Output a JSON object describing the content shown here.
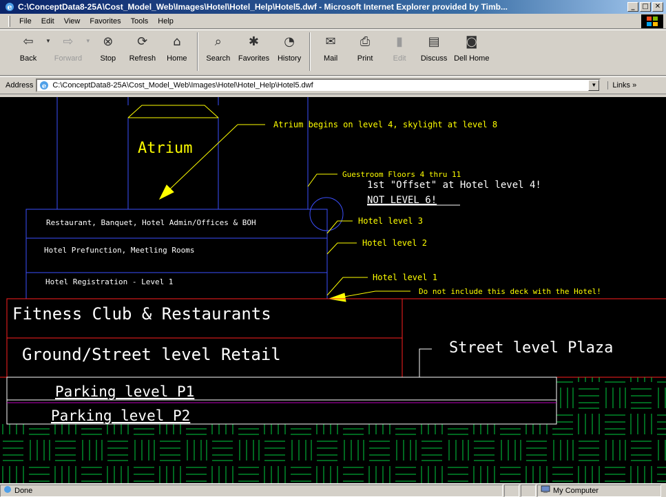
{
  "window": {
    "title": "C:\\ConceptData8-25A\\Cost_Model_Web\\Images\\Hotel\\Hotel_Help\\Hotel5.dwf - Microsoft Internet Explorer provided by Timb...",
    "minimize": "_",
    "maximize": "□",
    "close": "✕"
  },
  "menu": {
    "items": [
      "File",
      "Edit",
      "View",
      "Favorites",
      "Tools",
      "Help"
    ]
  },
  "toolbar": {
    "back": "Back",
    "forward": "Forward",
    "stop": "Stop",
    "refresh": "Refresh",
    "home": "Home",
    "search": "Search",
    "favorites": "Favorites",
    "history": "History",
    "mail": "Mail",
    "print": "Print",
    "edit": "Edit",
    "discuss": "Discuss",
    "dellhome": "Dell Home"
  },
  "address": {
    "label": "Address",
    "url": "C:\\ConceptData8-25A\\Cost_Model_Web\\Images\\Hotel\\Hotel_Help\\Hotel5.dwf",
    "links": "Links »"
  },
  "drawing": {
    "atrium": "Atrium",
    "atrium_note": "Atrium begins on level 4, skylight at level 8",
    "guestroom_note": "Guestroom Floors 4 thru 11",
    "offset_note": "1st \"Offset\" at Hotel level 4!",
    "not_level": "NOT LEVEL 6!",
    "level3_box": "Restaurant, Banquet, Hotel Admin/Offices & BOH",
    "level3_label": "Hotel level 3",
    "level2_box": "Hotel Prefunction, Meetling Rooms",
    "level2_label": "Hotel level 2",
    "level1_box": "Hotel Registration - Level 1",
    "level1_label": "Hotel level 1",
    "deck_note": "Do not include this deck with the Hotel!",
    "fitness": "Fitness Club & Restaurants",
    "retail": "Ground/Street level Retail",
    "plaza": "Street level Plaza",
    "parking1": "Parking level P1",
    "parking2": "Parking level P2",
    "colors": {
      "yellow": "#ffff00",
      "blue": "#3c50ff",
      "red": "#ff2020",
      "green": "#00d040",
      "white": "#ffffff"
    }
  },
  "status": {
    "text": "Done",
    "zone": "My Computer"
  }
}
